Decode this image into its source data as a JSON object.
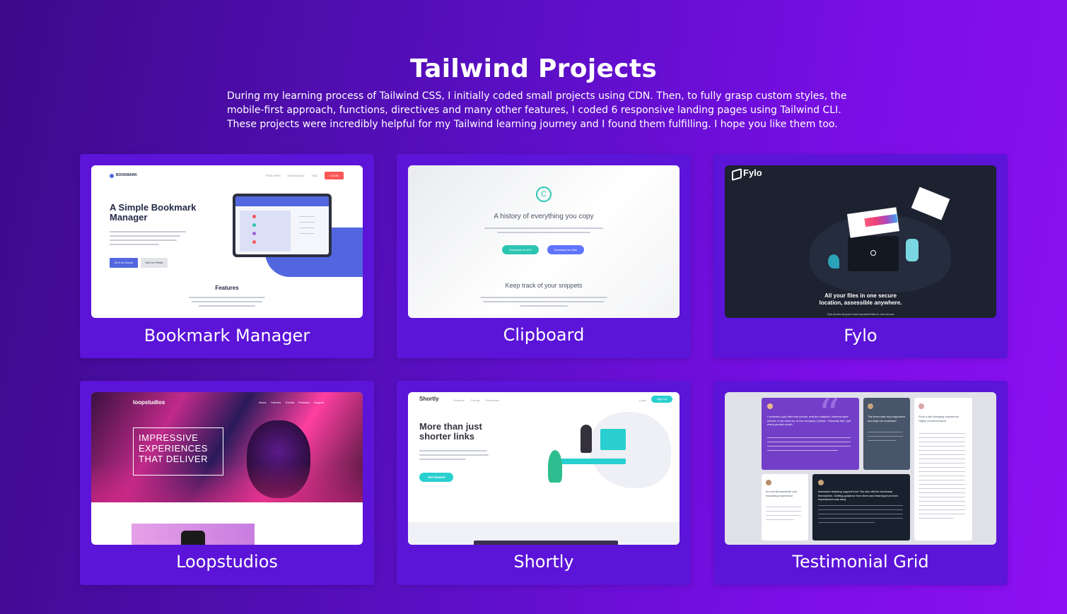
{
  "page": {
    "title": "Tailwind Projects",
    "intro": "During my learning process of Tailwind CSS, I initially coded small projects using CDN. Then, to fully grasp custom styles, the mobile-first approach, functions, directives and many other features, I coded 6 responsive landing pages using Tailwind CLI. These projects were incredibly helpful for my Tailwind learning journey and I found them fulfilling. I hope you like them too."
  },
  "projects": [
    {
      "label": "Bookmark Manager",
      "preview": {
        "logo": "BOOKMARK",
        "nav": [
          "FEATURES",
          "DOWNLOAD",
          "FAQ"
        ],
        "login": "LOGIN",
        "headline": "A Simple Bookmark Manager",
        "btn1": "Get it on Chrome",
        "btn2": "Get it on Firefox",
        "section": "Features"
      }
    },
    {
      "label": "Clipboard",
      "preview": {
        "headline": "A history of everything you copy",
        "btn1": "Download for iOS",
        "btn2": "Download for Mac",
        "section": "Keep track of your snippets"
      }
    },
    {
      "label": "Fylo",
      "preview": {
        "logo": "Fylo",
        "headline": "All your files in one secure location, assessible anywhere.",
        "sub": "Fylo stores all your most important files in one secure"
      }
    },
    {
      "label": "Loopstudios",
      "preview": {
        "logo": "loopstudios",
        "nav": [
          "About",
          "Careers",
          "Events",
          "Products",
          "Support"
        ],
        "headline": "IMPRESSIVE EXPERIENCES THAT DELIVER"
      }
    },
    {
      "label": "Shortly",
      "preview": {
        "logo": "Shortly",
        "nav": [
          "Features",
          "Pricing",
          "Resources"
        ],
        "login": "Login",
        "signup": "Sign Up",
        "headline": "More than just shorter links",
        "btn1": "Get Started"
      }
    },
    {
      "label": "Testimonial Grid",
      "preview": {
        "q1": "I received a job offer mid-course, and the subjects I learned were current, if not more so, in the company I joined. I honestly feel I got every penny's worth.",
        "q2": "The team was very supportive and kept me motivated",
        "q3": "Such a life-changing experience. Highly recommended!",
        "q4": "An overall wonderful and rewarding experience",
        "q5": "Awesome teaching support from TAs who did the bootcamp themselves. Getting guidance from them and learning from their experiences was easy."
      }
    }
  ],
  "colors": {
    "card": "#5b14d8",
    "accent_bookmark": "#5267df",
    "accent_clipboard": "#2cc5b3",
    "accent_shortly": "#2acfcf",
    "testimonial_purple": "#733fc8"
  },
  "icons": [
    "bookmark-logo-icon",
    "clipboard-icon",
    "fylo-logo-icon",
    "folder-icon"
  ]
}
